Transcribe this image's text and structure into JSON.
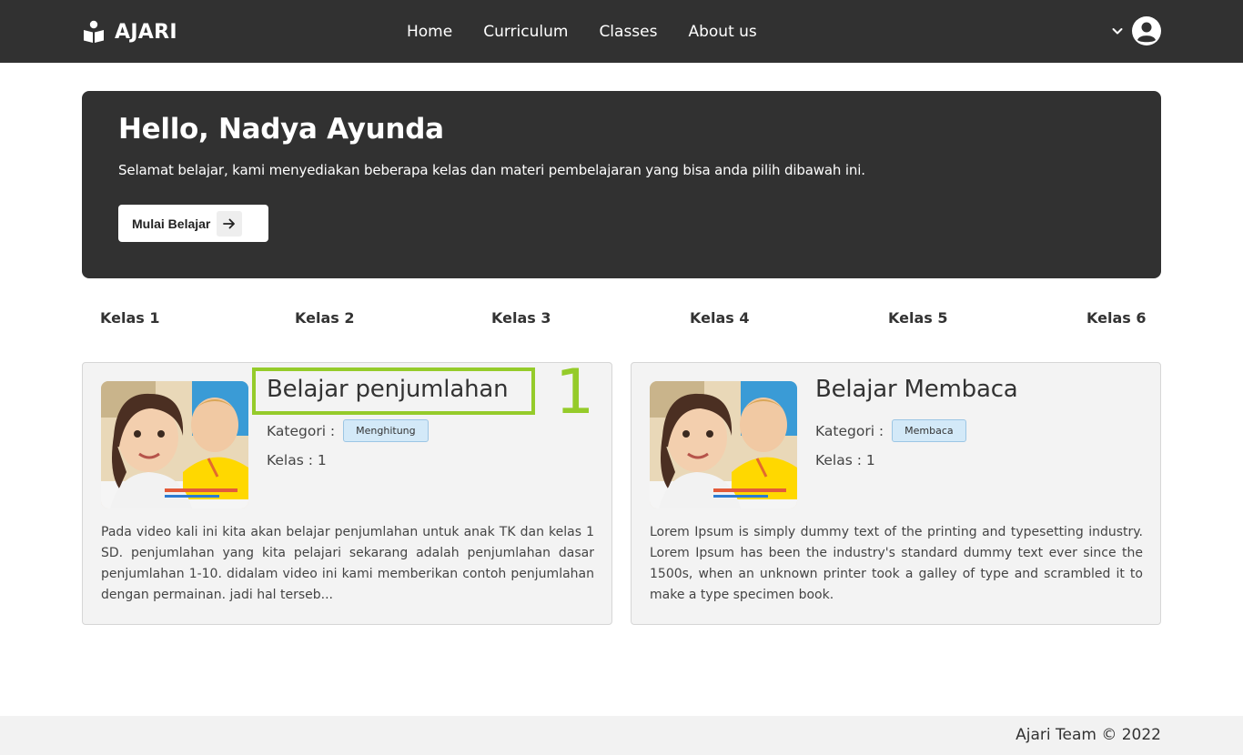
{
  "navbar": {
    "brand": "AJARI",
    "links": [
      "Home",
      "Curriculum",
      "Classes",
      "About us"
    ]
  },
  "hero": {
    "title": "Hello, Nadya Ayunda",
    "subtitle": "Selamat belajar, kami menyediakan beberapa kelas dan materi pembelajaran yang bisa anda pilih dibawah ini.",
    "button_label": "Mulai Belajar"
  },
  "class_tabs": [
    "Kelas 1",
    "Kelas 2",
    "Kelas 3",
    "Kelas 4",
    "Kelas 5",
    "Kelas 6"
  ],
  "cards": [
    {
      "title": "Belajar penjumlahan",
      "category_label": "Kategori :",
      "category": "Menghitung",
      "kelas": "Kelas : 1",
      "description": "Pada video kali ini kita akan belajar penjumlahan untuk anak TK dan kelas 1 SD. penjumlahan yang kita pelajari sekarang adalah penjumlahan dasar penjumlahan 1-10. didalam video ini kami memberikan contoh penjumlahan dengan permainan. jadi hal terseb..."
    },
    {
      "title": "Belajar Membaca",
      "category_label": "Kategori :",
      "category": "Membaca",
      "kelas": "Kelas : 1",
      "description": "Lorem Ipsum is simply dummy text of the printing and typesetting industry. Lorem Ipsum has been the industry's standard dummy text ever since the 1500s, when an unknown printer took a galley of type and scrambled it to make a type specimen book."
    }
  ],
  "annotation": {
    "label": "1",
    "color": "#95cb2a"
  },
  "footer": {
    "text": "Ajari Team © 2022"
  },
  "colors": {
    "dark": "#313131",
    "badge_bg": "#d3e9f8",
    "card_bg": "#f3f3f3"
  },
  "icons": {
    "brand": "book-reader-icon",
    "user_menu": "chevron-down-icon",
    "avatar": "user-circle-icon",
    "button": "arrow-right-icon"
  }
}
